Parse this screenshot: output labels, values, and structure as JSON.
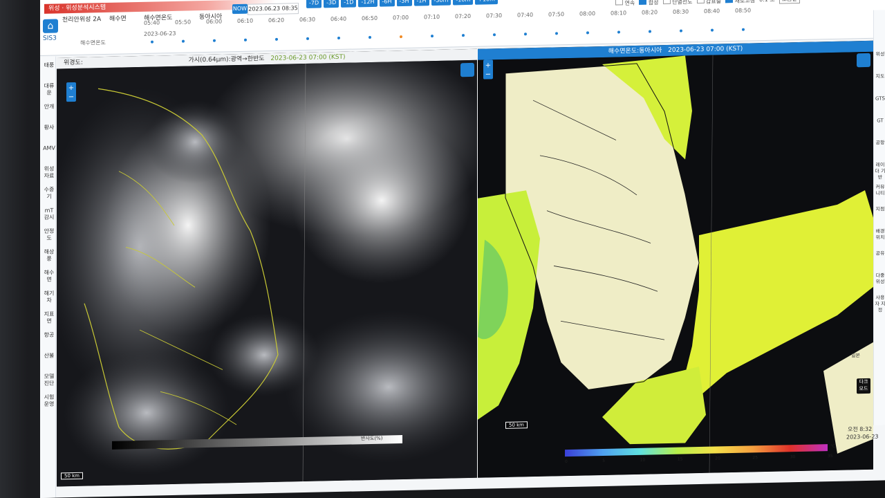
{
  "header": {
    "tab_text": "위성 · 위성분석시스템",
    "brand": "SIS3",
    "satellite_select": "천리안위성 2A",
    "product_select": "해수면",
    "product_select2": "해수면온도",
    "region_select": "동아시아",
    "now_label": "NOW",
    "date_value": "2023.06.23 08:35",
    "step_buttons": [
      "-7D",
      "-3D",
      "-1D",
      "-12H",
      "-6H",
      "-3H",
      "-1H",
      "-30m",
      "-10m",
      "+10m"
    ],
    "timeline_date": "2023-06-23",
    "timeline_left_label": "해수면온도",
    "timeline_times": [
      "05:40",
      "05:50",
      "06:00",
      "06:10",
      "06:20",
      "06:30",
      "06:40",
      "06:50",
      "07:00",
      "07:10",
      "07:20",
      "07:30",
      "07:40",
      "07:50",
      "08:00",
      "08:10",
      "08:20",
      "08:30",
      "08:40",
      "08:50"
    ],
    "active_time_index": 8,
    "controls": [
      "연속",
      "합성",
      "단열선도",
      "갑표출",
      "새로고침"
    ],
    "interval": "0.1 초",
    "help": "도움말"
  },
  "sidebar": {
    "items": [
      "태풍",
      "대류운",
      "안개",
      "황사",
      "AMV",
      "위성자료",
      "수증기",
      "mT 감시",
      "안정도",
      "해상풍",
      "해수면",
      "해기차",
      "지표면",
      "항공",
      "산불",
      "모델 진단",
      "시험 운영"
    ]
  },
  "right_sidebar": {
    "items": [
      "위성",
      "지도",
      "GTS",
      "GT",
      "공항",
      "레이더 기반",
      "커뮤니티",
      "지점",
      "배경 위치",
      "공유",
      "다중 위성",
      "사용자 지정"
    ]
  },
  "left_panel": {
    "title": "가시(0.64μm):광역→한반도",
    "time": "2023-06-23 07:00 (KST)",
    "coord_label": "위경도:",
    "scale_label": "50 km",
    "colorbar_label": "반사도(%)"
  },
  "right_panel": {
    "title": "해수면온도:동아시아",
    "time": "2023-06-23 07:00 (KST)",
    "scale_label": "50 km",
    "colorbar_ticks": [
      "0",
      "5",
      "10",
      "15",
      "20",
      "25",
      "30",
      "35"
    ],
    "colorbar_unit": "°C",
    "dark_mode_label": "다크 모드",
    "clock": "오전 8:32",
    "clock_date": "2023-06-23",
    "map_label": "일본"
  },
  "colors": {
    "accent": "#1f7fd1",
    "sst_low": "#3a3fd8",
    "sst_mid": "#b8f04a",
    "sst_high": "#e0312a",
    "cloud_dark": "#0c0d10",
    "land_pale": "#efedc6",
    "coast": "#d4d23c"
  }
}
